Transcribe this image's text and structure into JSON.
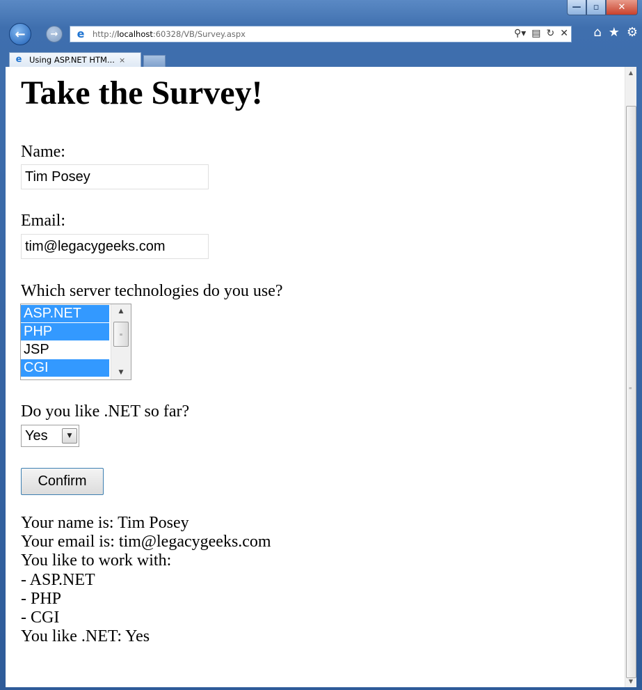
{
  "browser": {
    "url_prefix": "http://",
    "url_host": "localhost",
    "url_rest": ":60328/VB/Survey.aspx",
    "tab_title": "Using ASP.NET HTM...",
    "tab_close": "×",
    "icons": [
      "back-icon",
      "forward-icon",
      "ie-logo-icon",
      "search-icon",
      "compat-icon",
      "refresh-icon",
      "stop-icon",
      "home-icon",
      "favorites-icon",
      "tools-icon"
    ]
  },
  "page": {
    "heading": "Take the Survey!",
    "name_label": "Name:",
    "name_value": "Tim Posey",
    "email_label": "Email:",
    "email_value": "tim@legacygeeks.com",
    "tech_label": "Which server technologies do you use?",
    "tech_options": [
      {
        "label": "ASP.NET",
        "selected": true
      },
      {
        "label": "PHP",
        "selected": true
      },
      {
        "label": "JSP",
        "selected": false
      },
      {
        "label": "CGI",
        "selected": true
      }
    ],
    "net_label": "Do you like .NET so far?",
    "net_value": "Yes",
    "confirm_label": "Confirm",
    "results": {
      "name_line": "Your name is: Tim Posey",
      "email_line": "Your email is: tim@legacygeeks.com",
      "work_line": "You like to work with:",
      "tech_lines": [
        "- ASP.NET",
        "- PHP",
        "- CGI"
      ],
      "like_line": "You like .NET: Yes"
    }
  },
  "colors": {
    "selection": "#3399ff",
    "button_border": "#3c7fb1",
    "frame": "#3f6fae"
  }
}
